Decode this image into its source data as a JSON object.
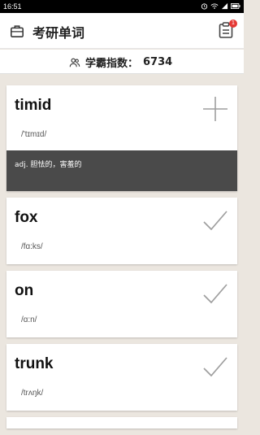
{
  "status": {
    "time": "16:51"
  },
  "header": {
    "title": "考研单词",
    "badge": "1"
  },
  "score": {
    "label": "学霸指数：",
    "value": "6734"
  },
  "cards": [
    {
      "word": "timid",
      "phonetic": "/'tɪmɪd/",
      "definition": "adj. 胆怯的，害羞的",
      "action": "add-icon"
    },
    {
      "word": "fox",
      "phonetic": "/fɑ:ks/",
      "action": "check-icon"
    },
    {
      "word": "on",
      "phonetic": "/ɑ:n/",
      "action": "check-icon"
    },
    {
      "word": "trunk",
      "phonetic": "/trʌŋk/",
      "action": "check-icon"
    }
  ],
  "colors": {
    "definition_bg": "#4a4a4a",
    "badge": "#e53935",
    "page_bg": "#ebe6df"
  }
}
